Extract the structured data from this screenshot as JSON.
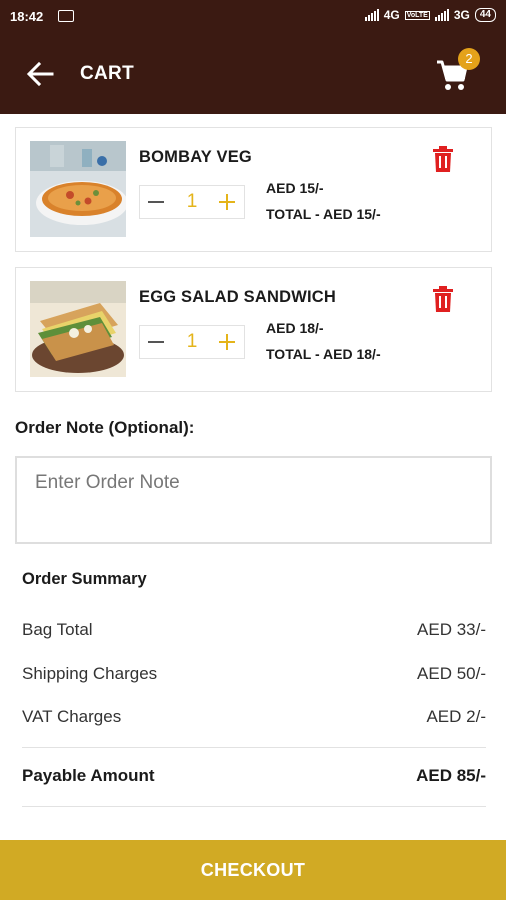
{
  "status_bar": {
    "time": "18:42",
    "network_1": "4G",
    "volte": "VoLTE",
    "network_2": "3G",
    "battery": "44"
  },
  "header": {
    "title": "CART",
    "cart_count": "2"
  },
  "cart": {
    "items": [
      {
        "name": "BOMBAY VEG",
        "quantity": "1",
        "price": "AED 15/-",
        "total": "TOTAL - AED 15/-"
      },
      {
        "name": "EGG SALAD SANDWICH",
        "quantity": "1",
        "price": "AED 18/-",
        "total": "TOTAL - AED 18/-"
      }
    ]
  },
  "order_note": {
    "label": "Order Note (Optional):",
    "placeholder": "Enter Order Note",
    "value": ""
  },
  "summary": {
    "title": "Order Summary",
    "bag_total": {
      "label": "Bag Total",
      "value": "AED 33/-"
    },
    "shipping": {
      "label": "Shipping Charges",
      "value": "AED 50/-"
    },
    "vat": {
      "label": "VAT Charges",
      "value": "AED 2/-"
    },
    "payable": {
      "label": "Payable Amount",
      "value": "AED 85/-"
    }
  },
  "checkout_label": "CHECKOUT",
  "colors": {
    "header_bg": "#3b1a12",
    "accent_yellow": "#e4b41a",
    "checkout_bg": "#d1aa24",
    "delete_red": "#e02020",
    "badge": "#e4a21a"
  },
  "icons": {
    "back": "arrow-left-icon",
    "cart": "shopping-cart-icon",
    "delete": "trash-icon",
    "minus": "minus-icon",
    "plus": "plus-icon"
  }
}
